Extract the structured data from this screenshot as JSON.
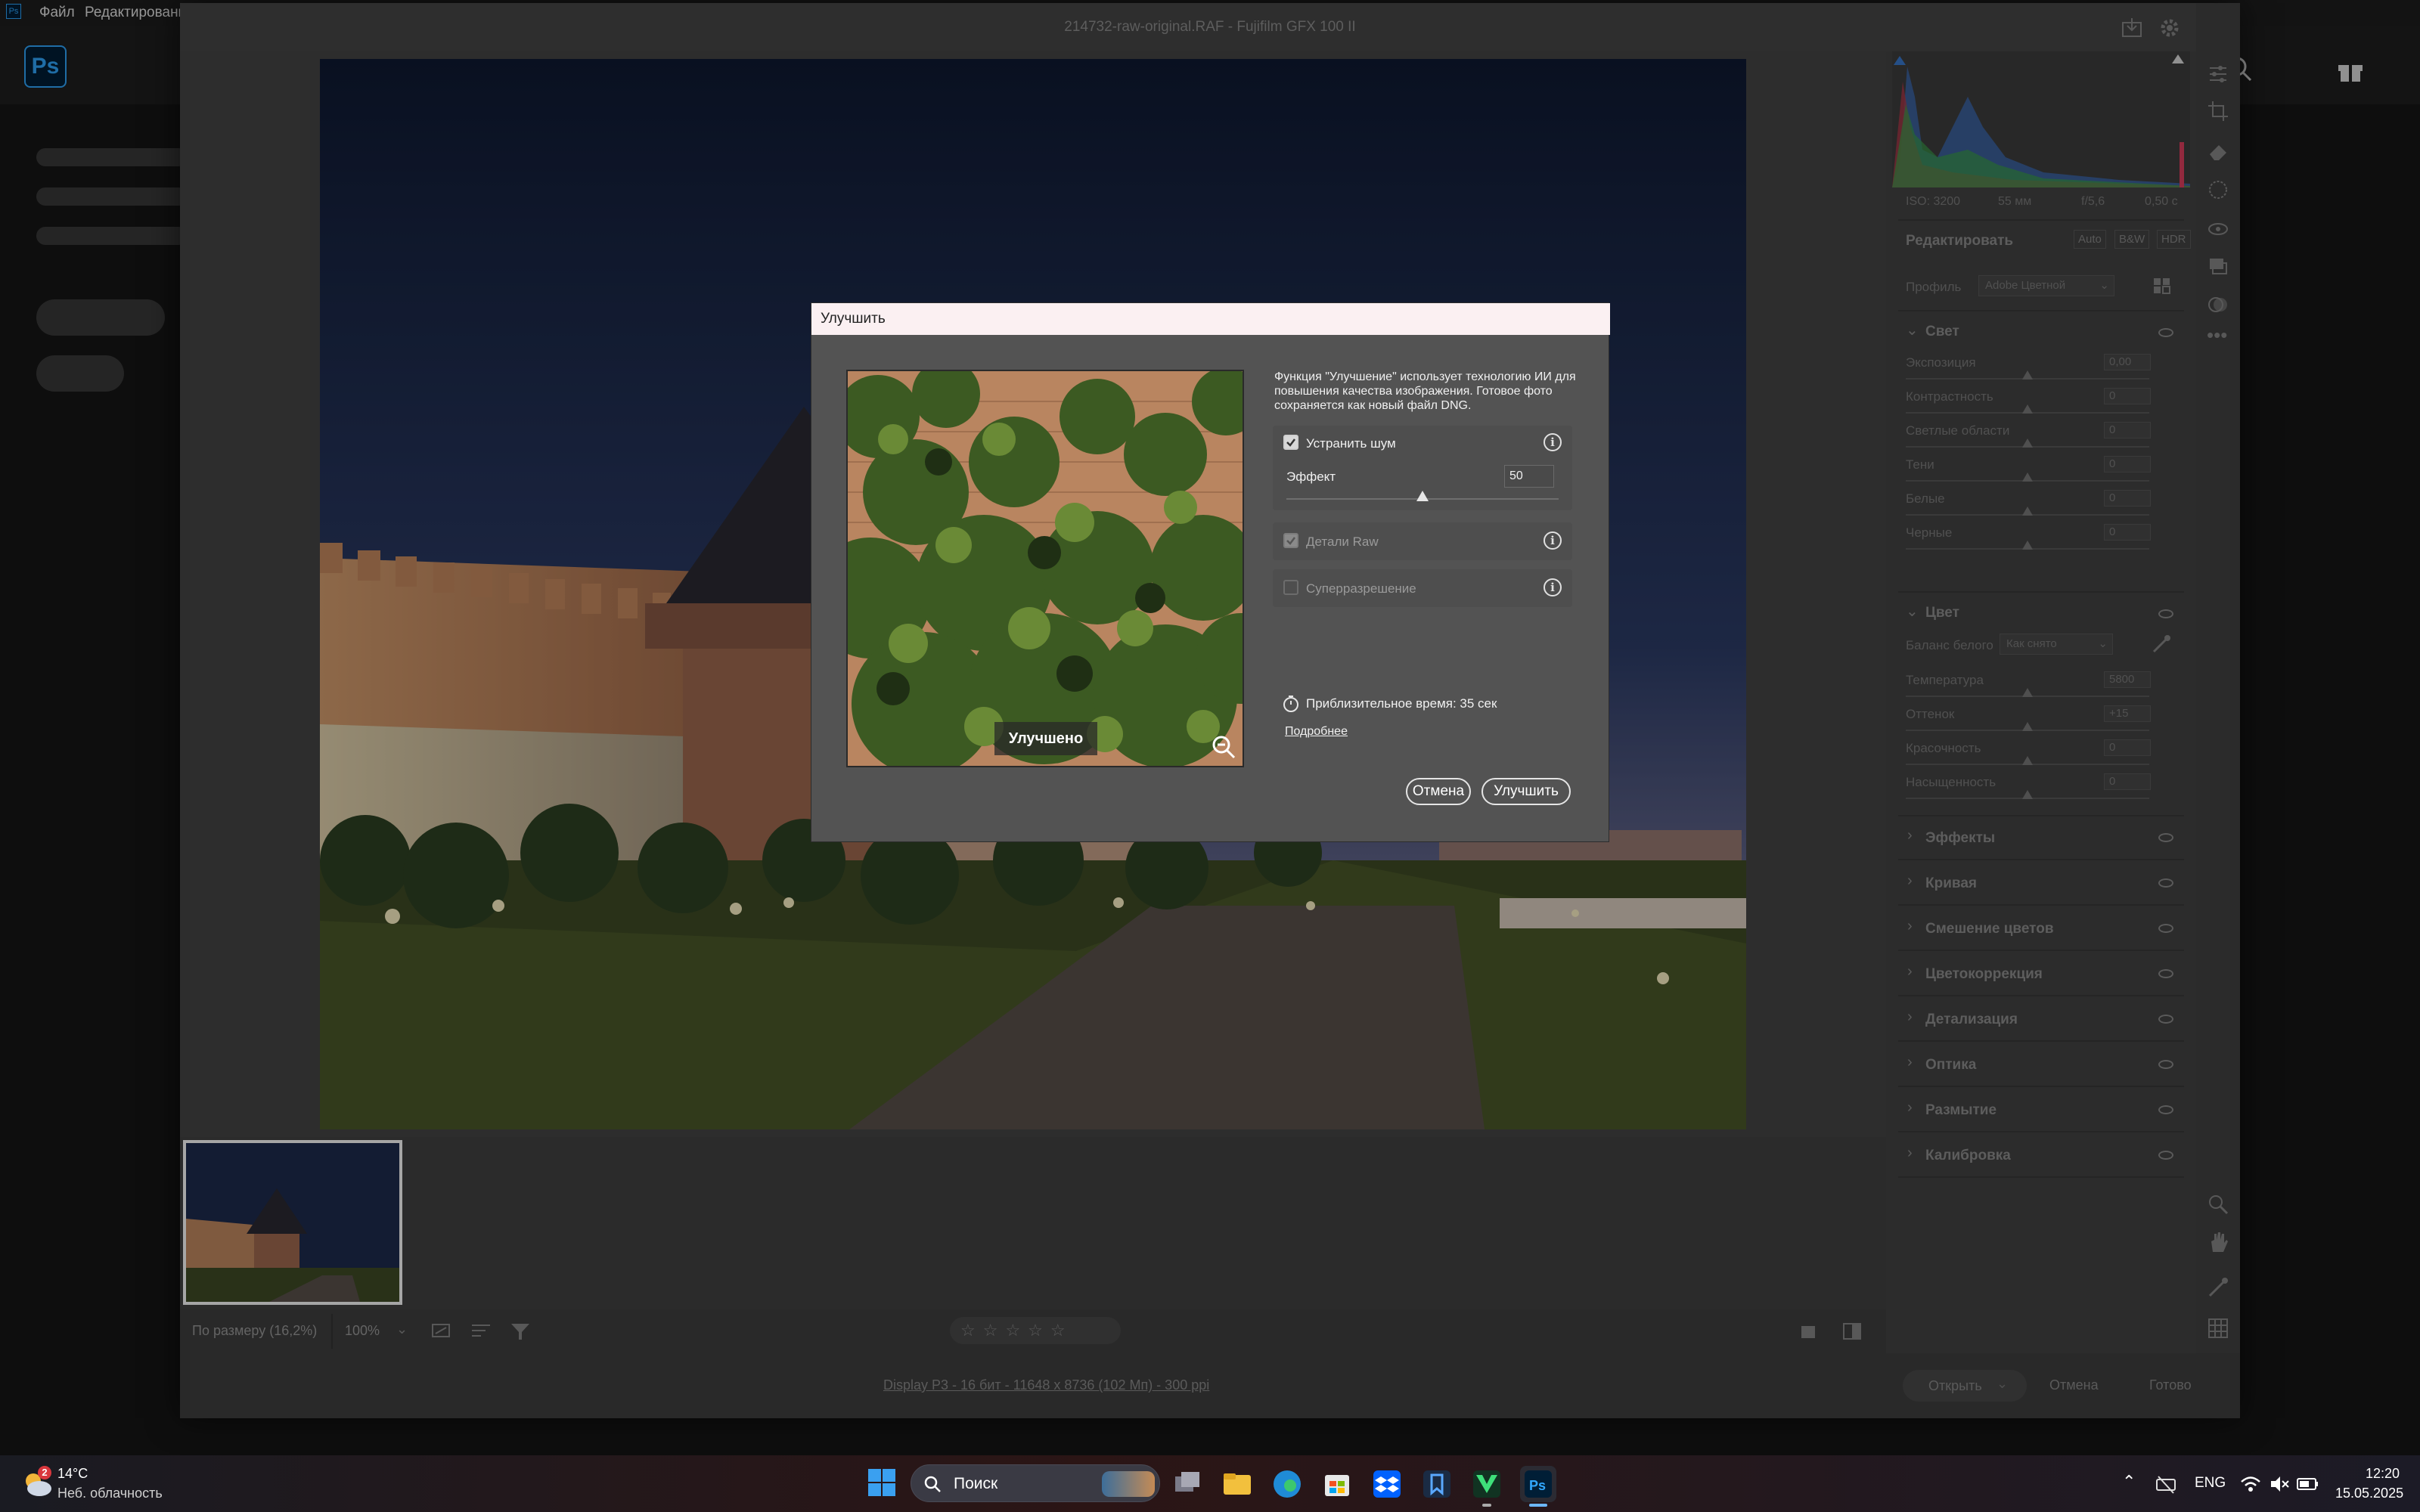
{
  "ps_menu": {
    "file": "Файл",
    "edit": "Редактировани"
  },
  "ps_logo": "Ps",
  "window_title": "214732-raw-original.RAF  -  Fujifilm GFX 100 II",
  "histogram_info": {
    "iso": "ISO: 3200",
    "focal": "55 мм",
    "aperture": "f/5,6",
    "shutter": "0,50 с"
  },
  "edit_section": {
    "title": "Редактировать",
    "auto": "Auto",
    "bw": "B&W",
    "hdr": "HDR",
    "profile_label": "Профиль",
    "profile_value": "Adobe Цветной"
  },
  "light": {
    "title": "Свет",
    "rows": [
      {
        "label": "Экспозиция",
        "value": "0,00"
      },
      {
        "label": "Контрастность",
        "value": "0"
      },
      {
        "label": "Светлые области",
        "value": "0"
      },
      {
        "label": "Тени",
        "value": "0"
      },
      {
        "label": "Белые",
        "value": "0"
      },
      {
        "label": "Черные",
        "value": "0"
      }
    ]
  },
  "color": {
    "title": "Цвет",
    "wb_label": "Баланс белого",
    "wb_value": "Как снято",
    "rows": [
      {
        "label": "Температура",
        "value": "5800"
      },
      {
        "label": "Оттенок",
        "value": "+15"
      },
      {
        "label": "Красочность",
        "value": "0"
      },
      {
        "label": "Насыщенность",
        "value": "0"
      }
    ]
  },
  "collapsed_sections": [
    "Эффекты",
    "Кривая",
    "Смешение цветов",
    "Цветокоррекция",
    "Детализация",
    "Оптика",
    "Размытие",
    "Калибровка"
  ],
  "bottom_toolbar": {
    "fit": "По размеру (16,2%)",
    "zoom": "100%"
  },
  "status": {
    "file_info": "Display P3 - 16 бит - 11648 x 8736 (102 Мп) - 300 ppi",
    "open": "Открыть",
    "cancel": "Отмена",
    "done": "Готово"
  },
  "dialog": {
    "title": "Улучшить",
    "description": "Функция \"Улучшение\" использует технологию ИИ для повышения качества изображения. Готовое фото сохраняется как новый файл DNG.",
    "preview_label": "Улучшено",
    "denoise": {
      "label": "Устранить шум",
      "checked": true,
      "effect_label": "Эффект",
      "effect_value": "50",
      "level": 50
    },
    "raw_details": {
      "label": "Детали Raw",
      "checked": true
    },
    "super_res": {
      "label": "Суперразрешение",
      "checked": false
    },
    "estimated_time": "Приблизительное время: 35 сек",
    "more_link": "Подробнее",
    "cancel": "Отмена",
    "enhance": "Улучшить"
  },
  "taskbar": {
    "weather_temp": "14°C",
    "weather_desc": "Неб. облачность",
    "weather_badge": "2",
    "search": "Поиск",
    "lang": "ENG",
    "time": "12:20",
    "date": "15.05.2025"
  }
}
